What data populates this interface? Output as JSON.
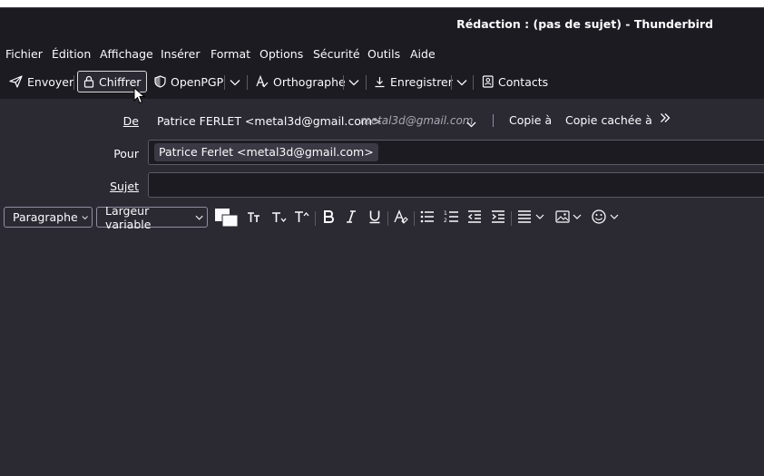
{
  "window": {
    "title": "Rédaction : (pas de sujet) - Thunderbird"
  },
  "menu": {
    "items": [
      "Fichier",
      "Édition",
      "Affichage",
      "Insérer",
      "Format",
      "Options",
      "Sécurité",
      "Outils",
      "Aide"
    ]
  },
  "toolbar": {
    "send": "Envoyer",
    "encrypt": "Chiffrer",
    "openpgp": "OpenPGP",
    "spelling": "Orthographe",
    "save": "Enregistrer",
    "contacts": "Contacts"
  },
  "headers": {
    "from_label": "De",
    "from_name": "Patrice FERLET <metal3d@gmail.com>",
    "from_address": "metal3d@gmail.com",
    "cc": "Copie à",
    "bcc": "Copie cachée à",
    "to_label": "Pour",
    "to_recipient": "Patrice Ferlet <metal3d@gmail.com>",
    "subject_label": "Sujet",
    "subject_value": ""
  },
  "format_bar": {
    "paragraph": "Paragraphe",
    "font": "Largeur variable"
  },
  "colors": {
    "background": "#2b2a33",
    "chrome": "#1c1b22",
    "text": "#fbfbfe",
    "muted": "#a9a9b2"
  }
}
